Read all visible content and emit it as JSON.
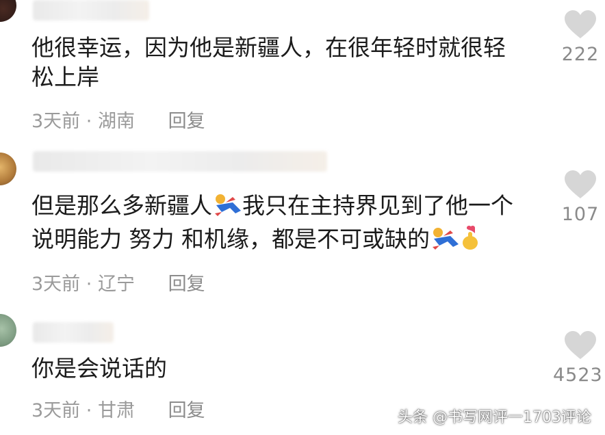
{
  "comments": [
    {
      "text_line1": "他很幸运，因为他是新疆人，在很年轻时就很轻",
      "text_line2": "松上岸",
      "time": "3天前",
      "separator": "·",
      "location": "湖南",
      "reply_label": "回复",
      "likes": "222"
    },
    {
      "text_line1_a": "但是那么多新疆人",
      "text_line1_b": "我只在主持界见到了他一个",
      "text_line2": "说明能力 努力 和机缘，都是不可或缺的",
      "time": "3天前",
      "separator": "·",
      "location": "辽宁",
      "reply_label": "回复",
      "likes": "107"
    },
    {
      "text_line1": "你是会说话的",
      "time": "3天前",
      "separator": "·",
      "location": "甘肃",
      "reply_label": "回复",
      "likes": "4523"
    }
  ],
  "watermark": "头条 @书写网评一1703评论",
  "icons": {
    "like": "heart-icon",
    "emoji_a": "running-person-emoji",
    "emoji_b": "finger-heart-emoji"
  },
  "colors": {
    "text": "#1b1b1b",
    "meta": "#9a9a9a",
    "heart": "#d6d6d6"
  }
}
